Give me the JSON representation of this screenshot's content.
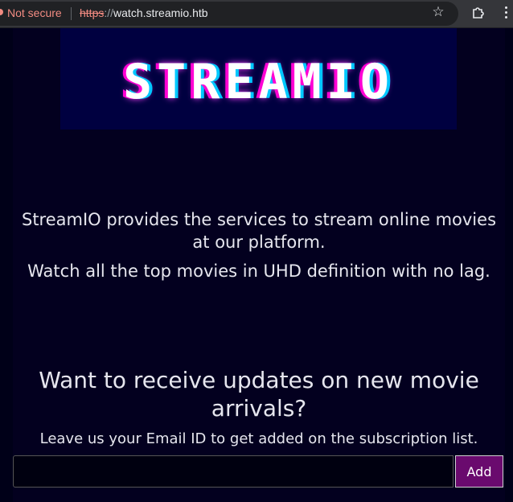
{
  "browser": {
    "security_label": "Not secure",
    "url_scheme": "https",
    "url_slashes": "://",
    "url_host": "watch.streamio.htb",
    "icons": [
      "warning-icon",
      "star-icon",
      "extensions-icon",
      "menu-icon"
    ]
  },
  "header": {
    "logo_text": "STREAMIO"
  },
  "intro": {
    "line1": "StreamIO provides the services to stream online movies at our platform.",
    "line2": "Watch all the top movies in UHD definition with no lag."
  },
  "subscribe": {
    "title": "Want to receive updates on new movie arrivals?",
    "subtitle": "Leave us your Email ID to get added on the subscription list.",
    "email_value": "",
    "email_placeholder": "",
    "add_label": "Add"
  },
  "colors": {
    "page_bg": "#03001f",
    "logo_bg": "#000040",
    "logo_pink": "#ff00d4",
    "logo_cyan": "#00c8ff",
    "button_bg": "#6a0a6e",
    "warning": "#f28b82"
  }
}
